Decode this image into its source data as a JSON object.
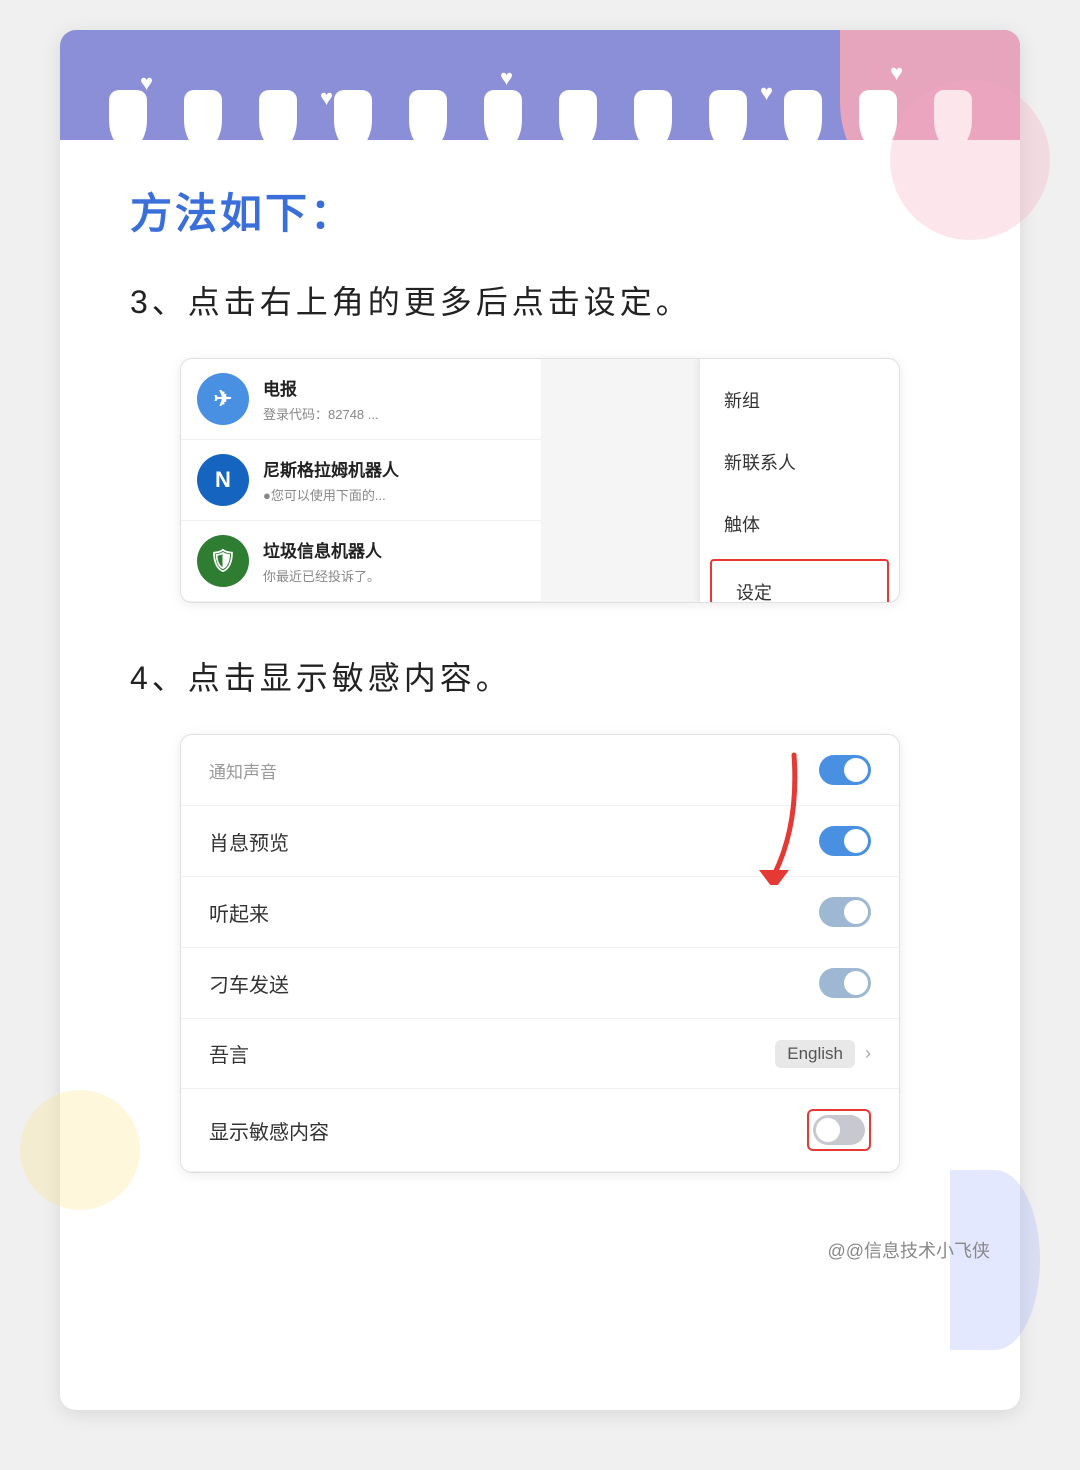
{
  "page": {
    "title": "方法如下：",
    "step3_text": "3、点击右上角的更多后点击设定。",
    "step4_text": "4、点击显示敏感内容。",
    "watermark": "@@信息技术小飞侠"
  },
  "chat_items": [
    {
      "name": "电报",
      "sub": "登录代码：82748 ...",
      "color": "#4a90e2",
      "letter": "✈"
    },
    {
      "name": "尼斯格拉姆机器人",
      "sub": "●您可以使用下面的...",
      "color": "#1976d2",
      "letter": "N"
    },
    {
      "name": "垃圾信息机器人",
      "sub": "你最近已经投诉了。",
      "color": "#43a047",
      "letter": "🛡"
    }
  ],
  "menu_items": [
    {
      "label": "新组",
      "highlighted": false
    },
    {
      "label": "新联系人",
      "highlighted": false
    },
    {
      "label": "触体",
      "highlighted": false
    },
    {
      "label": "设定",
      "highlighted": true
    }
  ],
  "settings_items": [
    {
      "label": "通知声音",
      "type": "toggle",
      "state": "on",
      "top": true
    },
    {
      "label": "肖息预览",
      "type": "toggle",
      "state": "on"
    },
    {
      "label": "听起来",
      "type": "toggle",
      "state": "half"
    },
    {
      "label": "刁车发送",
      "type": "toggle",
      "state": "half"
    },
    {
      "label": "吾言",
      "type": "lang",
      "lang": "English"
    },
    {
      "label": "显示敏感内容",
      "type": "toggle",
      "state": "off",
      "highlighted": true
    }
  ]
}
